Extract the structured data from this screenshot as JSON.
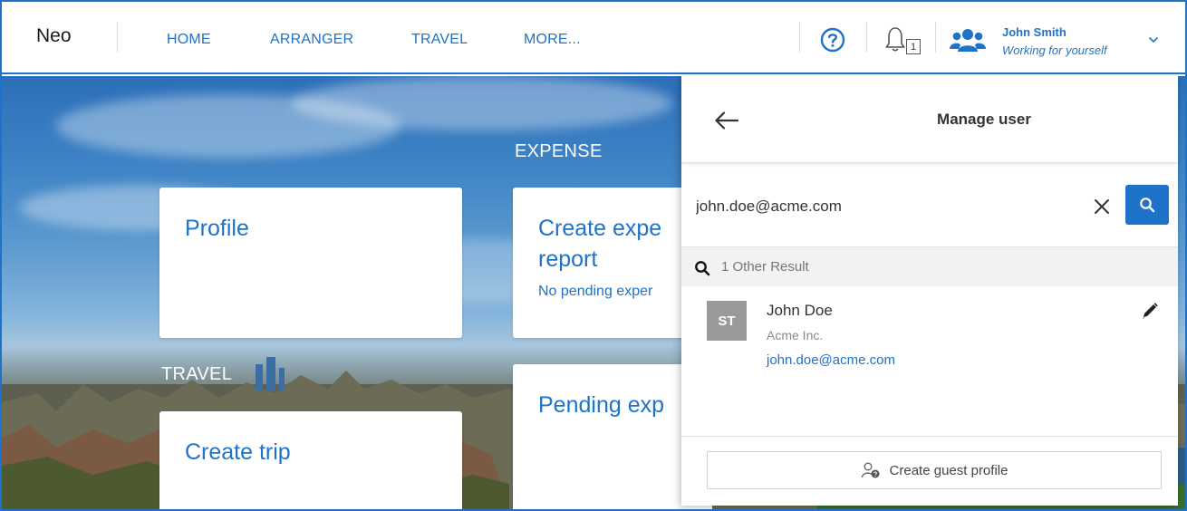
{
  "nav": {
    "brand": "Neo",
    "items": [
      {
        "label": "HOME"
      },
      {
        "label": "ARRANGER"
      },
      {
        "label": "TRAVEL"
      },
      {
        "label": "MORE..."
      }
    ],
    "notification_count": "1",
    "user": {
      "name": "John Smith",
      "subtitle": "Working for yourself"
    }
  },
  "dashboard": {
    "sections": {
      "expense": "EXPENSE",
      "travel": "TRAVEL"
    },
    "tiles": {
      "profile": {
        "title": "Profile"
      },
      "create_expense": {
        "title_line1": "Create expe",
        "title_line2": "report",
        "sub": "No pending exper"
      },
      "pending_expense": {
        "title": "Pending exp"
      },
      "create_trip": {
        "title": "Create trip"
      }
    }
  },
  "panel": {
    "title": "Manage user",
    "search": {
      "value": "john.doe@acme.com",
      "placeholder": ""
    },
    "results_summary": "1 Other Result",
    "results": [
      {
        "initials": "ST",
        "name": "John Doe",
        "company": "Acme Inc.",
        "email": "john.doe@acme.com"
      }
    ],
    "guest_button_label": "Create guest profile"
  },
  "colors": {
    "accent": "#1e73c8",
    "avatar": "#9a9a9a"
  },
  "icons": [
    "help-icon",
    "bell-icon",
    "users-icon",
    "chevron-down-icon",
    "back-arrow-icon",
    "close-icon",
    "search-icon",
    "pencil-icon",
    "guest-user-icon"
  ]
}
